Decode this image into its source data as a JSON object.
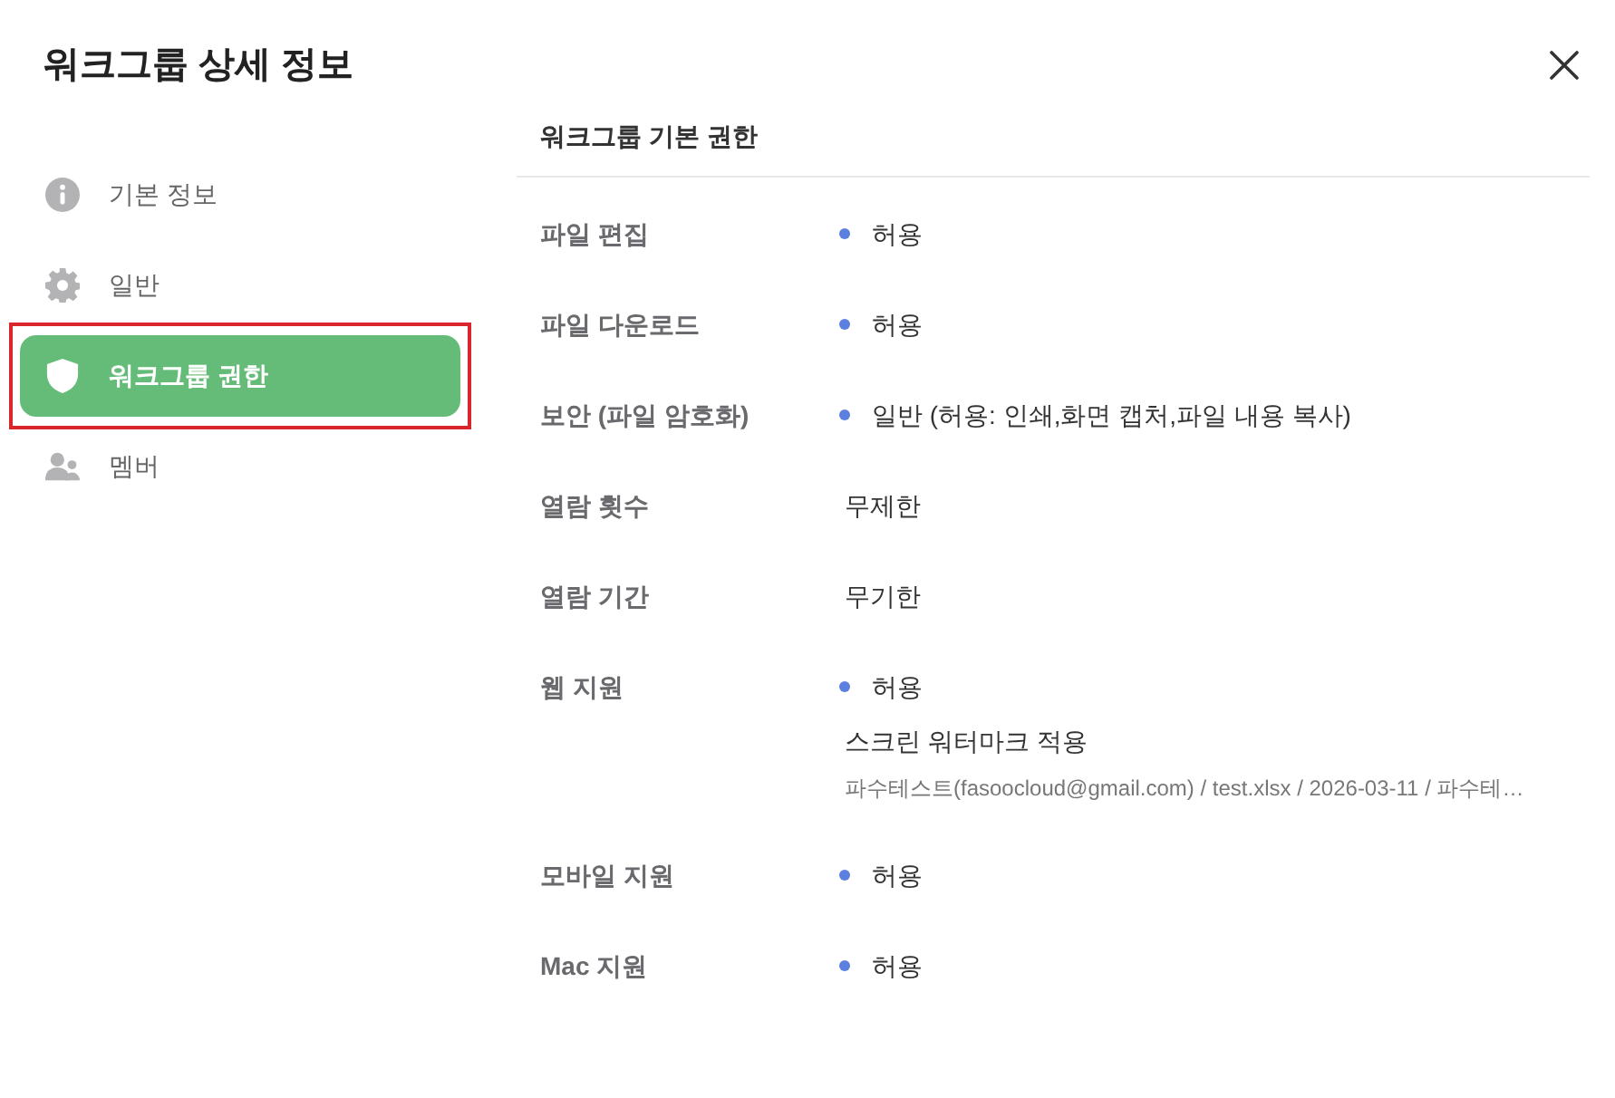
{
  "dialog": {
    "title": "워크그룹 상세 정보"
  },
  "sidebar": {
    "items": [
      {
        "label": "기본 정보",
        "selected": false,
        "highlighted": false
      },
      {
        "label": "일반",
        "selected": false,
        "highlighted": false
      },
      {
        "label": "워크그룹 권한",
        "selected": true,
        "highlighted": true
      },
      {
        "label": "멤버",
        "selected": false,
        "highlighted": false
      }
    ]
  },
  "section": {
    "title": "워크그룹 기본 권한",
    "rows": [
      {
        "label": "파일 편집",
        "lines": [
          {
            "kind": "status",
            "text": "허용"
          }
        ]
      },
      {
        "label": "파일 다운로드",
        "lines": [
          {
            "kind": "status",
            "text": "허용"
          }
        ]
      },
      {
        "label": "보안 (파일 암호화)",
        "lines": [
          {
            "kind": "status",
            "text": "일반 (허용: 인쇄,화면 캡처,파일 내용 복사)"
          }
        ]
      },
      {
        "label": "열람 횟수",
        "lines": [
          {
            "kind": "plain",
            "text": "무제한"
          }
        ]
      },
      {
        "label": "열람 기간",
        "lines": [
          {
            "kind": "plain",
            "text": "무기한"
          }
        ]
      },
      {
        "label": "웹 지원",
        "lines": [
          {
            "kind": "status",
            "text": "허용"
          },
          {
            "kind": "plain",
            "text": "스크린 워터마크 적용"
          },
          {
            "kind": "note",
            "text": "파수테스트(fasoocloud@gmail.com) / test.xlsx / 2026-03-11 / 파수테…"
          }
        ]
      },
      {
        "label": "모바일 지원",
        "lines": [
          {
            "kind": "status",
            "text": "허용"
          }
        ]
      },
      {
        "label": "Mac 지원",
        "lines": [
          {
            "kind": "status",
            "text": "허용"
          }
        ]
      }
    ]
  }
}
